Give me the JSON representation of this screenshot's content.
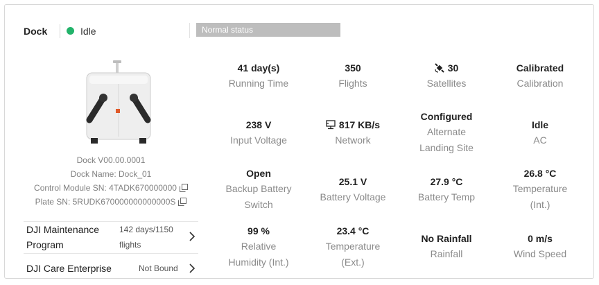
{
  "header": {
    "title": "Dock",
    "status": "Idle",
    "status_color": "#22b36a",
    "banner": "Normal status"
  },
  "device": {
    "image_icon": "dock-device-image",
    "firmware": "Dock V00.00.0001",
    "name": "Dock Name: Dock_01",
    "control_module_sn": "Control Module SN: 4TADK670000000",
    "plate_sn": "Plate SN: 5RUDK670000000000000S"
  },
  "services": [
    {
      "name_line1": "DJI Maintenance",
      "name_line2": "Program",
      "value_line1": "142 days/1150",
      "value_line2": "flights"
    },
    {
      "name_line1": "DJI Care Enterprise",
      "value_line1": "Not Bound"
    }
  ],
  "metrics": {
    "running_time": {
      "value": "41 day(s)",
      "label": "Running Time"
    },
    "flights": {
      "value": "350",
      "label": "Flights"
    },
    "satellites": {
      "value": "30",
      "label": "Satellites",
      "icon": "satellite-icon"
    },
    "calibration": {
      "value": "Calibrated",
      "label": "Calibration"
    },
    "input_voltage": {
      "value": "238 V",
      "label": "Input Voltage"
    },
    "network": {
      "value": "817 KB/s",
      "label": "Network",
      "icon": "network-icon"
    },
    "alternate_landing": {
      "value": "Configured",
      "label1": "Alternate",
      "label2": "Landing Site"
    },
    "ac": {
      "value": "Idle",
      "label": "AC"
    },
    "backup_battery": {
      "value": "Open",
      "label1": "Backup Battery",
      "label2": "Switch"
    },
    "battery_voltage": {
      "value": "25.1 V",
      "label": "Battery Voltage"
    },
    "battery_temp": {
      "value": "27.9 °C",
      "label": "Battery Temp"
    },
    "temp_int": {
      "value": "26.8 °C",
      "label1": "Temperature",
      "label2": "(Int.)"
    },
    "humidity": {
      "value": "99 %",
      "label1": "Relative",
      "label2": "Humidity (Int.)"
    },
    "temp_ext": {
      "value": "23.4 °C",
      "label1": "Temperature",
      "label2": "(Ext.)"
    },
    "rainfall": {
      "value": "No Rainfall",
      "label": "Rainfall"
    },
    "wind": {
      "value": "0 m/s",
      "label": "Wind Speed"
    }
  }
}
